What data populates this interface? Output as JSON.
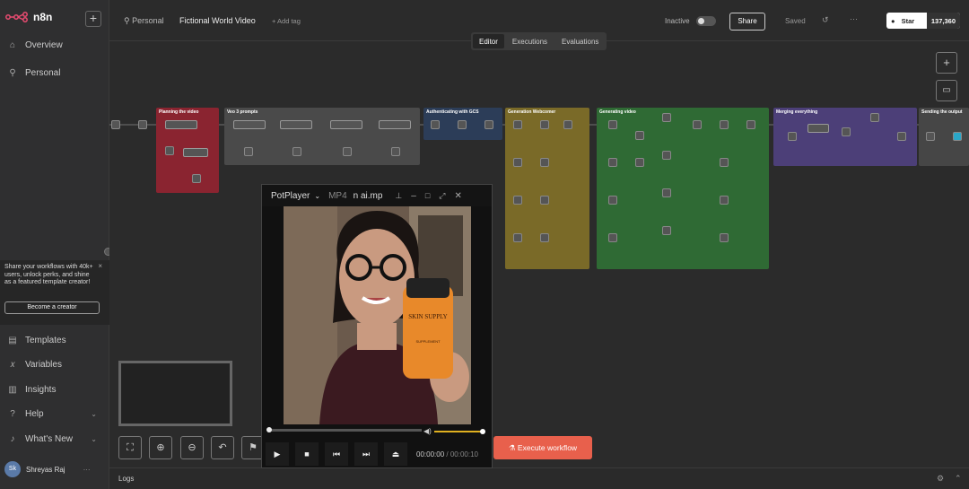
{
  "sidebar": {
    "logo": "n8n",
    "add_icon": "+",
    "nav": [
      {
        "label": "Overview",
        "icon": "home-icon"
      },
      {
        "label": "Personal",
        "icon": "user-icon"
      }
    ],
    "promo": {
      "text": "Share your workflows with 40k+ users, unlock perks, and shine as a featured template creator!",
      "button": "Become a creator",
      "close": "×"
    },
    "bottom_nav": [
      {
        "label": "Templates",
        "icon": "templates-icon"
      },
      {
        "label": "Variables",
        "icon": "variables-icon"
      },
      {
        "label": "Insights",
        "icon": "insights-icon"
      },
      {
        "label": "Help",
        "icon": "help-icon"
      },
      {
        "label": "What's New",
        "icon": "bell-icon"
      }
    ],
    "user": {
      "initials": "Sk",
      "name": "Shreyas Raj",
      "menu": "···"
    }
  },
  "header": {
    "breadcrumb": "Personal",
    "workflow_name": "Fictional World Video",
    "add_tag": "+ Add tag",
    "status": "Inactive",
    "share": "Share",
    "saved": "Saved",
    "github_star": "Star",
    "github_count": "137,360"
  },
  "tabs": [
    "Editor",
    "Executions",
    "Evaluations"
  ],
  "sticky_notes": [
    {
      "title": "Planning the video",
      "color": "#8a2430"
    },
    {
      "title": "Veo 3 prompts",
      "color": "#4a4a4a"
    },
    {
      "title": "Authenticating with GCS",
      "color": "#2c3d58"
    },
    {
      "title": "Generation Webcomer",
      "color": "#7a6a28"
    },
    {
      "title": "Generating video",
      "color": "#2f6a34"
    },
    {
      "title": "Merging everything",
      "color": "#4c3f78"
    },
    {
      "title": "Sending the output",
      "color": "#464646"
    }
  ],
  "canvas": {
    "execute_label": "Execute workflow"
  },
  "logs": {
    "label": "Logs"
  },
  "player": {
    "app": "PotPlayer",
    "format": "MP4",
    "filename": "n ai.mp",
    "time_current": "00:00:00",
    "time_sep": "/",
    "time_total": "00:00:10",
    "volume_fraction": 0.9,
    "progress_fraction": 0.0,
    "bottle_brand": "SKIN SUPPLY",
    "bottle_sub": "SUPPLEMENT"
  }
}
